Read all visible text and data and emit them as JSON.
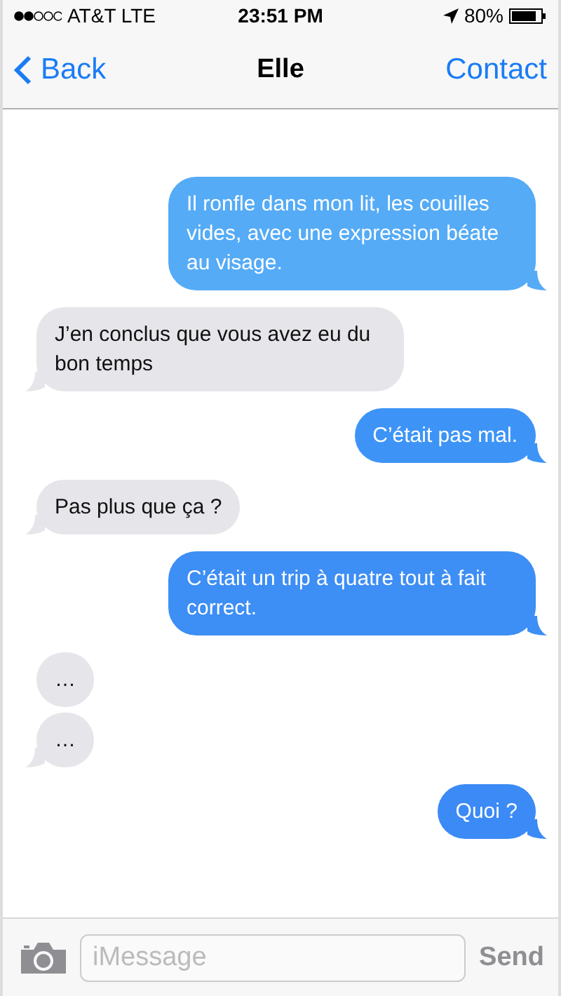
{
  "status_bar": {
    "carrier": "AT&T LTE",
    "time": "23:51 PM",
    "battery": "80%"
  },
  "nav": {
    "back": "Back",
    "title": "Elle",
    "action": "Contact"
  },
  "messages": [
    {
      "kind": "sent",
      "text": "Il ronfle dans mon lit, les couilles vides, avec une expression béate au visage.",
      "tail": true,
      "color": "#55abf6"
    },
    {
      "kind": "received",
      "text": "J’en conclus que vous avez eu du bon temps",
      "tail": true,
      "color": "#e5e5ea"
    },
    {
      "kind": "sent",
      "text": "C’était pas mal.",
      "tail": true,
      "color": "#3d94f6"
    },
    {
      "kind": "received",
      "text": "Pas plus que ça ?",
      "tail": true,
      "color": "#e5e5ea"
    },
    {
      "kind": "sent",
      "text": "C’était un trip à quatre tout à fait correct.",
      "tail": true,
      "color": "#3d8ef5"
    },
    {
      "kind": "received",
      "text": "…",
      "tail": false,
      "color": "#e5e5ea"
    },
    {
      "kind": "received",
      "text": "…",
      "tail": true,
      "color": "#e5e5ea"
    },
    {
      "kind": "sent",
      "text": "Quoi ?",
      "tail": true,
      "color": "#3b8af5"
    }
  ],
  "composer": {
    "placeholder": "iMessage",
    "send": "Send"
  }
}
